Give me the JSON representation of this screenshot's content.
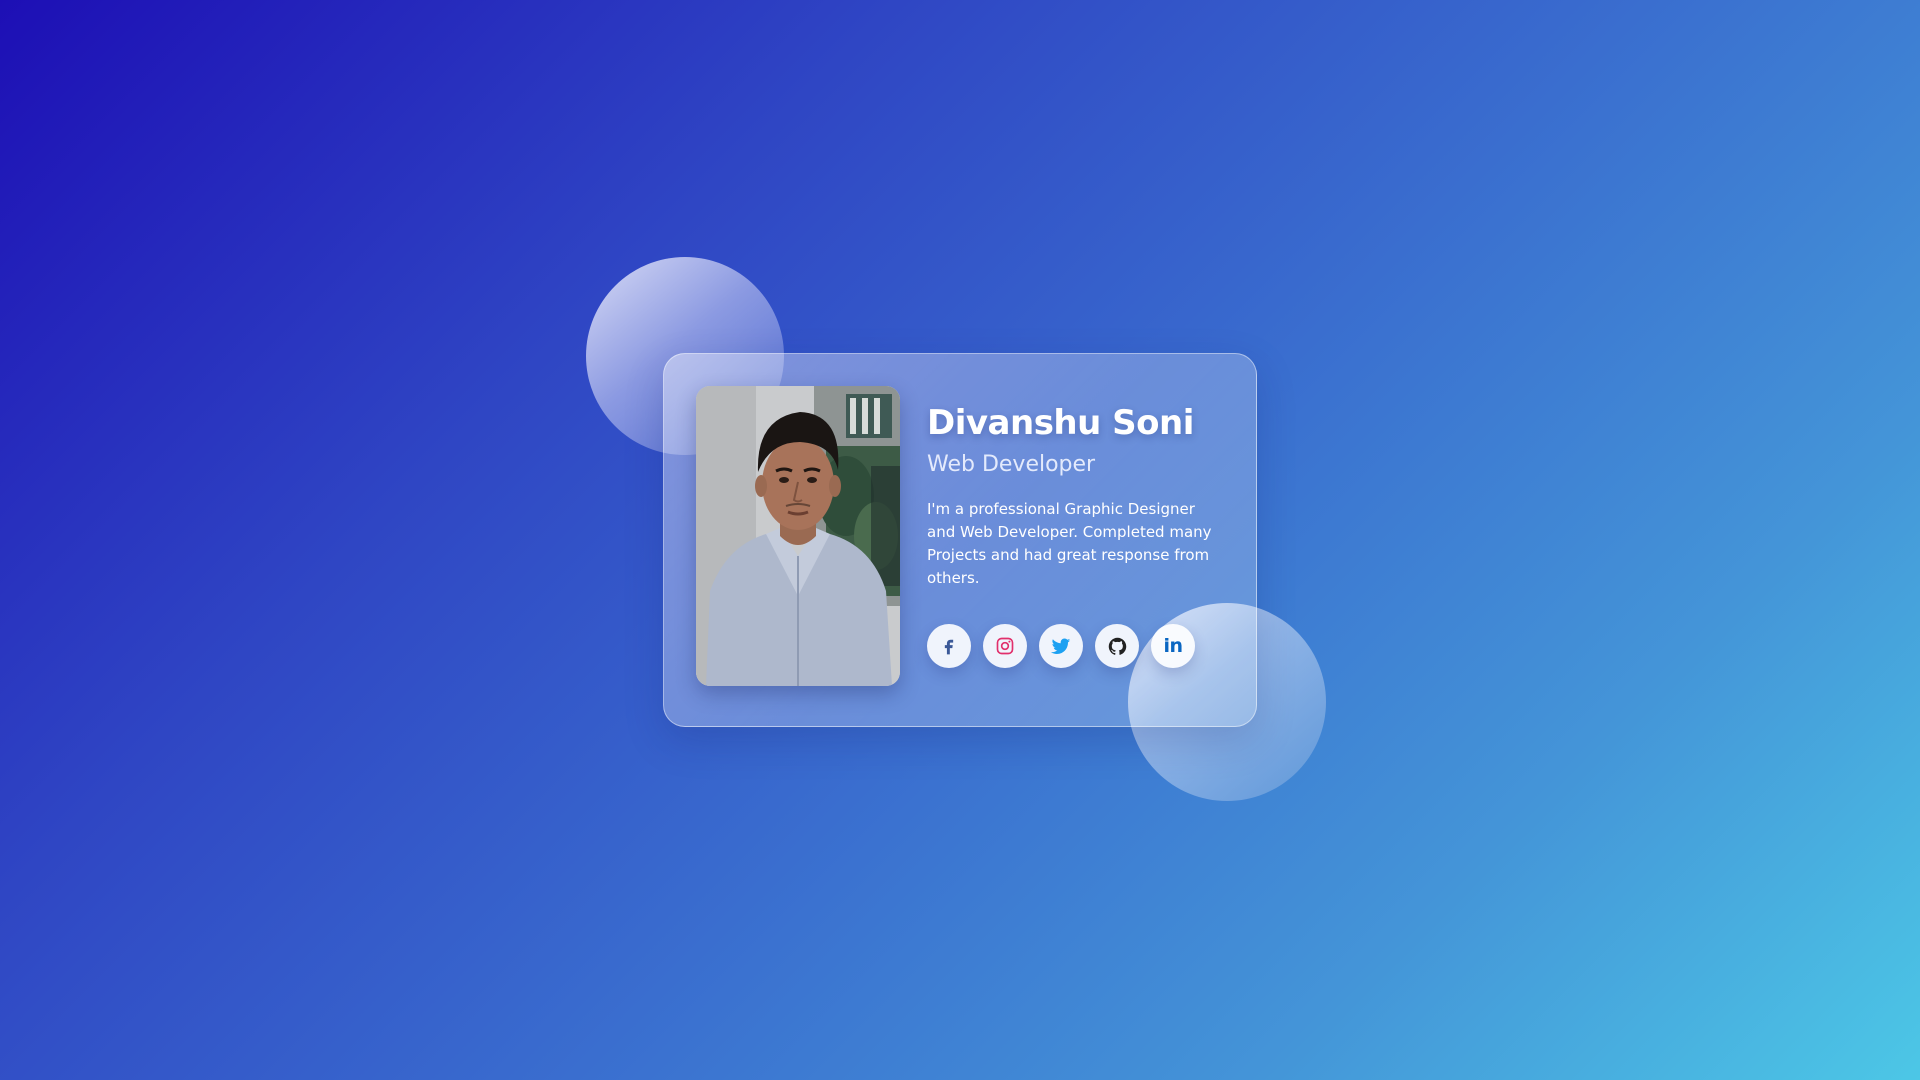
{
  "profile": {
    "name": "Divanshu Soni",
    "role": "Web Developer",
    "description": "I'm a professional Graphic Designer and Web Developer. Completed many Projects and had great response from others.",
    "photo_alt": "profile photo"
  },
  "socials": [
    {
      "name": "facebook",
      "icon": "facebook-icon",
      "color": "#3b5998"
    },
    {
      "name": "instagram",
      "icon": "instagram-icon",
      "color": "#e1306c"
    },
    {
      "name": "twitter",
      "icon": "twitter-icon",
      "color": "#1da1f2"
    },
    {
      "name": "github",
      "icon": "github-icon",
      "color": "#222222"
    },
    {
      "name": "linkedin",
      "icon": "linkedin-icon",
      "color": "#0a66c2",
      "glyph": "in"
    }
  ],
  "colors": {
    "background_start": "#1d0fb5",
    "background_end": "#4cc7e6",
    "text": "#ffffff"
  }
}
